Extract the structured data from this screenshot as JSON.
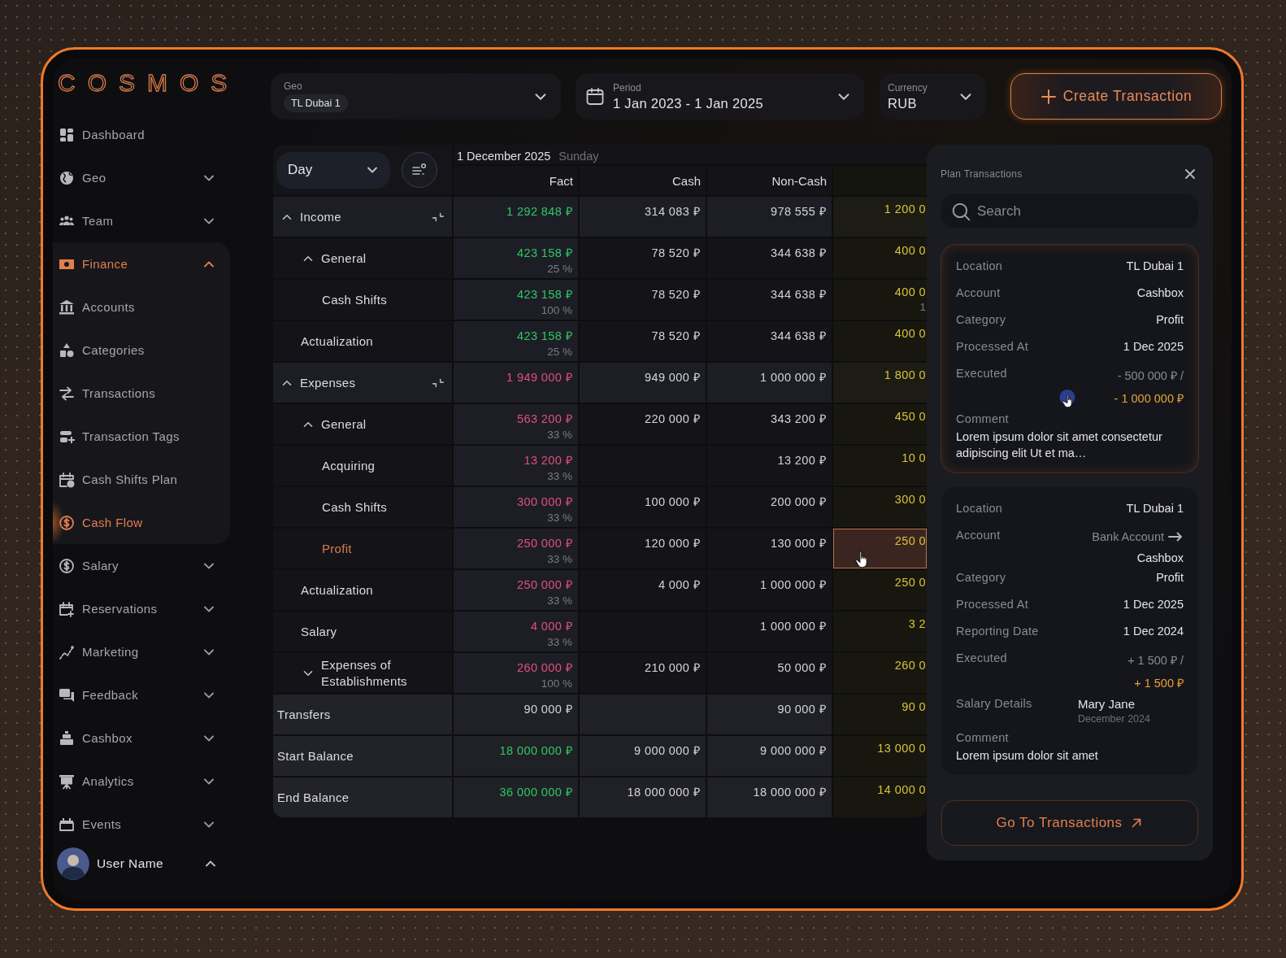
{
  "app": {
    "logo": "COSMOS"
  },
  "sidebar": {
    "items": [
      {
        "label": "Dashboard",
        "selected": false
      },
      {
        "label": "Geo",
        "expanded": false,
        "selected": false
      },
      {
        "label": "Team",
        "expanded": false,
        "selected": false
      },
      {
        "label": "Finance",
        "expanded": true,
        "selected": false,
        "children": [
          {
            "label": "Accounts",
            "selected": false
          },
          {
            "label": "Categories",
            "selected": false
          },
          {
            "label": "Transactions",
            "selected": false
          },
          {
            "label": "Transaction Tags",
            "selected": false
          },
          {
            "label": "Cash Shifts Plan",
            "selected": false
          },
          {
            "label": "Cash Flow",
            "selected": true
          }
        ]
      },
      {
        "label": "Salary",
        "expanded": false,
        "selected": false
      },
      {
        "label": "Reservations",
        "expanded": false,
        "selected": false
      },
      {
        "label": "Marketing",
        "expanded": false,
        "selected": false
      },
      {
        "label": "Feedback",
        "expanded": false,
        "selected": false
      },
      {
        "label": "Cashbox",
        "expanded": false,
        "selected": false
      },
      {
        "label": "Analytics",
        "expanded": false,
        "selected": false
      },
      {
        "label": "Events",
        "expanded": false,
        "selected": false
      }
    ],
    "user": {
      "name": "User Name",
      "expanded": true
    }
  },
  "filters": {
    "geo": {
      "label": "Geo",
      "chips": [
        "TL Dubai 1"
      ]
    },
    "period": {
      "label": "Period",
      "value": "1 Jan 2023 - 1 Jan 2025"
    },
    "currency": {
      "label": "Currency",
      "value": "RUB"
    }
  },
  "create_button": "Create Transaction",
  "table": {
    "granularity": "Day",
    "date": "1 December 2025",
    "weekday": "Sunday",
    "columns": [
      "Fact",
      "Cash",
      "Non-Cash"
    ],
    "rows": [
      {
        "label": "Income",
        "kind": "section",
        "expanded": true,
        "selected": false,
        "cells": [
          {
            "text": "1 292 848 ₽",
            "color": "#2ec866"
          },
          {
            "text": "314 083 ₽"
          },
          {
            "text": "978 555 ₽"
          },
          {
            "text": "1 200 0"
          }
        ],
        "children": [
          {
            "label": "General",
            "expanded": true,
            "selected": false,
            "cells": [
              {
                "text": "423 158 ₽",
                "share": "25 %",
                "color": "#2ec866"
              },
              {
                "text": "78 520 ₽"
              },
              {
                "text": "344 638 ₽"
              },
              {
                "text": "400 0"
              }
            ],
            "children": [
              {
                "label": "Cash Shifts",
                "selected": false,
                "cells": [
                  {
                    "text": "423 158 ₽",
                    "share": "100 %",
                    "color": "#2ec866"
                  },
                  {
                    "text": "78 520 ₽"
                  },
                  {
                    "text": "344 638 ₽"
                  },
                  {
                    "text": "400 0",
                    "share": "1"
                  }
                ]
              }
            ]
          },
          {
            "label": "Actualization",
            "selected": false,
            "cells": [
              {
                "text": "423 158 ₽",
                "share": "25 %",
                "color": "#2ec866"
              },
              {
                "text": "78 520 ₽"
              },
              {
                "text": "344 638 ₽"
              },
              {
                "text": "400 0"
              }
            ]
          }
        ]
      },
      {
        "label": "Expenses",
        "kind": "section",
        "expanded": true,
        "selected": false,
        "cells": [
          {
            "text": "1 949 000 ₽",
            "color": "#e04f7c"
          },
          {
            "text": "949 000 ₽"
          },
          {
            "text": "1 000 000 ₽"
          },
          {
            "text": "1 800 0"
          }
        ],
        "children": [
          {
            "label": "General",
            "expanded": true,
            "selected": false,
            "cells": [
              {
                "text": "563 200 ₽",
                "share": "33 %",
                "color": "#e04f7c"
              },
              {
                "text": "220 000 ₽"
              },
              {
                "text": "343 200 ₽"
              },
              {
                "text": "450 0"
              }
            ],
            "children": [
              {
                "label": "Acquiring",
                "selected": false,
                "cells": [
                  {
                    "text": "13 200 ₽",
                    "share": "33 %",
                    "color": "#e04f7c"
                  },
                  null,
                  {
                    "text": "13 200 ₽"
                  },
                  {
                    "text": "10 0"
                  }
                ]
              },
              {
                "label": "Cash Shifts",
                "selected": false,
                "cells": [
                  {
                    "text": "300 000 ₽",
                    "share": "33 %",
                    "color": "#e04f7c"
                  },
                  {
                    "text": "100 000 ₽"
                  },
                  {
                    "text": "200 000 ₽"
                  },
                  {
                    "text": "300 0"
                  }
                ]
              },
              {
                "label": "Profit",
                "selected": true,
                "cells": [
                  {
                    "text": "250 000 ₽",
                    "share": "33 %",
                    "color": "#e04f7c"
                  },
                  {
                    "text": "120 000 ₽"
                  },
                  {
                    "text": "130 000 ₽"
                  },
                  {
                    "text": "250 0"
                  }
                ]
              }
            ]
          },
          {
            "label": "Actualization",
            "selected": false,
            "cells": [
              {
                "text": "250 000 ₽",
                "share": "33 %",
                "color": "#e04f7c"
              },
              {
                "text": "4 000 ₽"
              },
              {
                "text": "1 000 000 ₽"
              },
              {
                "text": "250 0"
              }
            ]
          },
          {
            "label": "Salary",
            "selected": false,
            "cells": [
              {
                "text": "4 000 ₽",
                "share": "33 %",
                "color": "#e04f7c"
              },
              null,
              {
                "text": "1 000 000 ₽"
              },
              {
                "text": "3 2"
              }
            ]
          },
          {
            "label": "Expenses of Establishments",
            "expanded": false,
            "selected": false,
            "cells": [
              {
                "text": "260 000 ₽",
                "share": "100 %",
                "color": "#e04f7c"
              },
              {
                "text": "210 000 ₽"
              },
              {
                "text": "50 000 ₽"
              },
              {
                "text": "260 0"
              }
            ]
          }
        ]
      },
      {
        "label": "Transfers",
        "kind": "total",
        "selected": false,
        "cells": [
          {
            "text": "90 000 ₽"
          },
          null,
          {
            "text": "90 000 ₽"
          },
          {
            "text": "90 0"
          }
        ]
      },
      {
        "label": "Start Balance",
        "kind": "total",
        "selected": false,
        "cells": [
          {
            "text": "18 000 000 ₽",
            "color": "#2ec866"
          },
          {
            "text": "9 000 000 ₽"
          },
          {
            "text": "9 000 000 ₽"
          },
          {
            "text": "13 000 0"
          }
        ]
      },
      {
        "label": "End Balance",
        "kind": "total",
        "selected": false,
        "cells": [
          {
            "text": "36 000 000 ₽",
            "color": "#2ec866"
          },
          {
            "text": "18 000 000 ₽"
          },
          {
            "text": "18 000 000 ₽"
          },
          {
            "text": "14 000 0"
          }
        ]
      }
    ]
  },
  "panel": {
    "title": "Plan Transactions",
    "search": {
      "placeholder": "Search"
    },
    "cards": [
      {
        "selected": true,
        "fields": [
          {
            "kind": "text",
            "label": "Location",
            "value": "TL Dubai 1"
          },
          {
            "kind": "text",
            "label": "Account",
            "value": "Cashbox"
          },
          {
            "kind": "text",
            "label": "Category",
            "value": "Profit"
          },
          {
            "kind": "text",
            "label": "Processed At",
            "value": "1 Dec 2025"
          },
          {
            "kind": "executed",
            "label": "Executed",
            "fact": "- 500 000 ₽ /",
            "plan": "- 1 000 000 ₽"
          },
          {
            "kind": "comment",
            "label": "Comment",
            "text": "Lorem ipsum dolor sit amet consectetur adipiscing elit Ut et ma…"
          }
        ]
      },
      {
        "selected": false,
        "fields": [
          {
            "kind": "text",
            "label": "Location",
            "value": "TL Dubai 1"
          },
          {
            "kind": "transfer",
            "label": "Account",
            "from": "Bank Account",
            "to": "Cashbox"
          },
          {
            "kind": "text",
            "label": "Category",
            "value": "Profit"
          },
          {
            "kind": "text",
            "label": "Processed At",
            "value": "1 Dec 2025"
          },
          {
            "kind": "text",
            "label": "Reporting Date",
            "value": "1 Dec 2024"
          },
          {
            "kind": "executed",
            "label": "Executed",
            "fact": "+ 1 500 ₽ /",
            "plan": "+ 1 500 ₽"
          },
          {
            "kind": "person",
            "label": "Salary Details",
            "name": "Mary Jane",
            "period": "December 2024"
          },
          {
            "kind": "comment",
            "label": "Comment",
            "text": "Lorem ipsum dolor sit amet"
          }
        ]
      }
    ],
    "footer_button": "Go To Transactions"
  }
}
